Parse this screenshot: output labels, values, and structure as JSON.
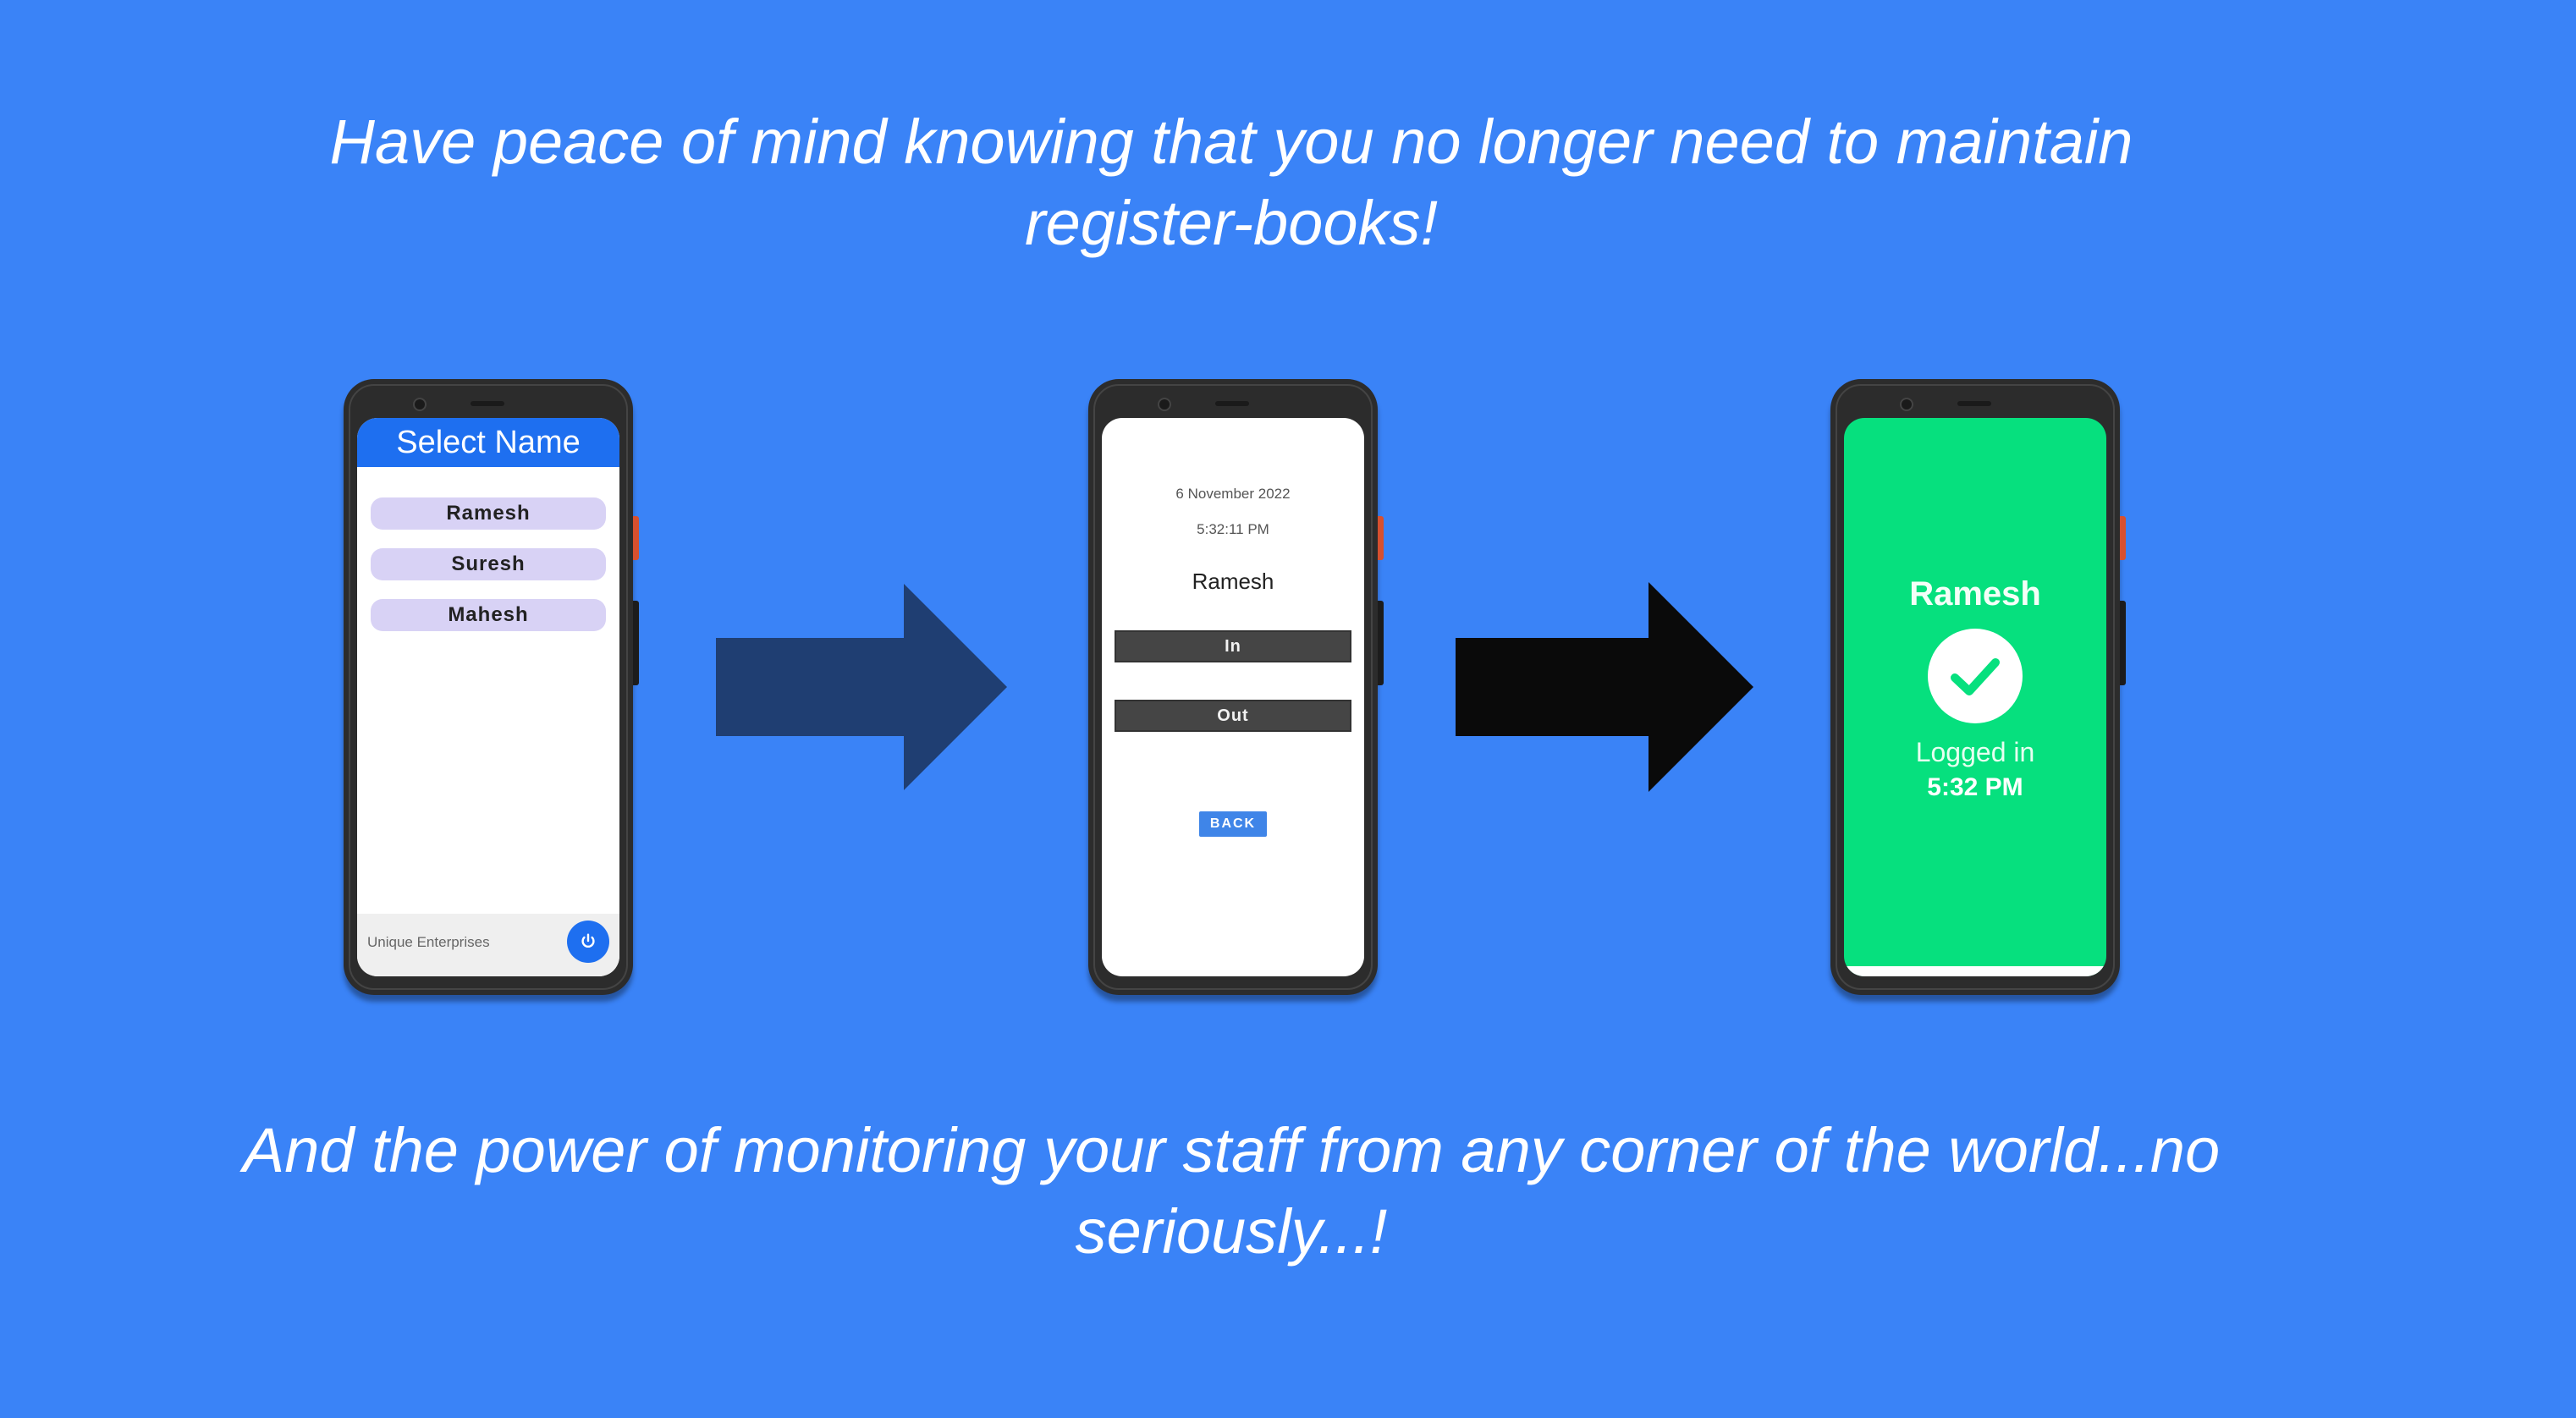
{
  "headline_top": "Have peace of mind knowing that you no longer need to maintain register-books!",
  "headline_bottom": "And the power of monitoring your staff from any corner of the world...no seriously...!",
  "screen1": {
    "header_title": "Select Name",
    "names": [
      "Ramesh",
      "Suresh",
      "Mahesh"
    ],
    "footer_company": "Unique Enterprises",
    "power_icon": "power-icon"
  },
  "screen2": {
    "date": "6 November 2022",
    "time": "5:32:11 PM",
    "name": "Ramesh",
    "in_label": "In",
    "out_label": "Out",
    "back_label": "BACK"
  },
  "screen3": {
    "name": "Ramesh",
    "status": "Logged in",
    "time": "5:32 PM",
    "icon": "check-circle-icon"
  },
  "colors": {
    "background": "#3a83f7",
    "header_blue": "#1e6ff0",
    "pill_lavender": "#d8d2f5",
    "success_green": "#06e07e",
    "arrow_navy": "#1f3e72",
    "arrow_black": "#0a0a0a"
  }
}
